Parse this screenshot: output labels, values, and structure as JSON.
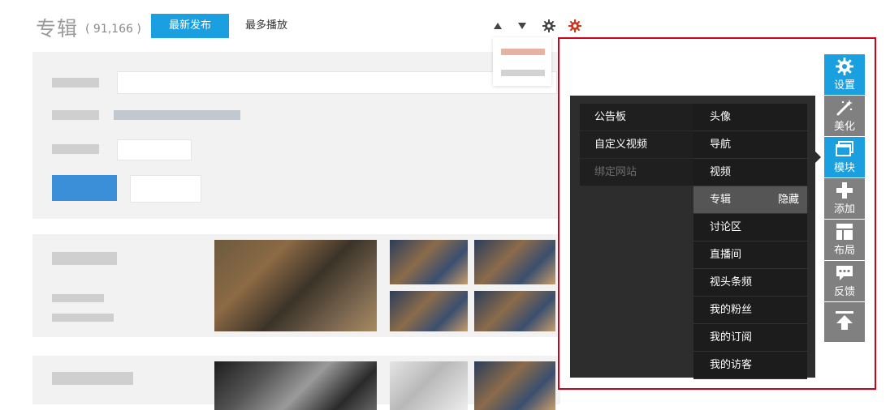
{
  "header": {
    "title": "专辑",
    "count": "( 91,166 )",
    "tabs": [
      {
        "label": "最新发布",
        "active": true
      },
      {
        "label": "最多播放",
        "active": false
      }
    ]
  },
  "colors": {
    "accent_blue": "#1a9fe0",
    "highlight_red": "#d0021b",
    "menu_dark": "#2d2d2d",
    "toolbar_gray": "#808080"
  },
  "menu": {
    "left_items": [
      {
        "label": "公告板",
        "disabled": false
      },
      {
        "label": "自定义视频",
        "disabled": false
      },
      {
        "label": "绑定网站",
        "disabled": true
      }
    ],
    "right_items": [
      {
        "label": "头像"
      },
      {
        "label": "导航"
      },
      {
        "label": "视频"
      },
      {
        "label": "专辑",
        "hover_action": "隐藏"
      },
      {
        "label": "讨论区"
      },
      {
        "label": "直播间"
      },
      {
        "label": "视头条频"
      },
      {
        "label": "我的粉丝"
      },
      {
        "label": "我的订阅"
      },
      {
        "label": "我的访客"
      }
    ]
  },
  "toolbar": {
    "items": [
      {
        "label": "设置",
        "icon": "gear-icon",
        "active": true
      },
      {
        "label": "美化",
        "icon": "magic-wand-icon",
        "active": false
      },
      {
        "label": "模块",
        "icon": "window-stack-icon",
        "active": true
      },
      {
        "label": "添加",
        "icon": "plus-icon",
        "active": false
      },
      {
        "label": "布局",
        "icon": "layout-icon",
        "active": false
      },
      {
        "label": "反馈",
        "icon": "chat-bubble-icon",
        "active": false
      },
      {
        "label": "",
        "icon": "back-to-top-icon",
        "active": false
      }
    ]
  }
}
